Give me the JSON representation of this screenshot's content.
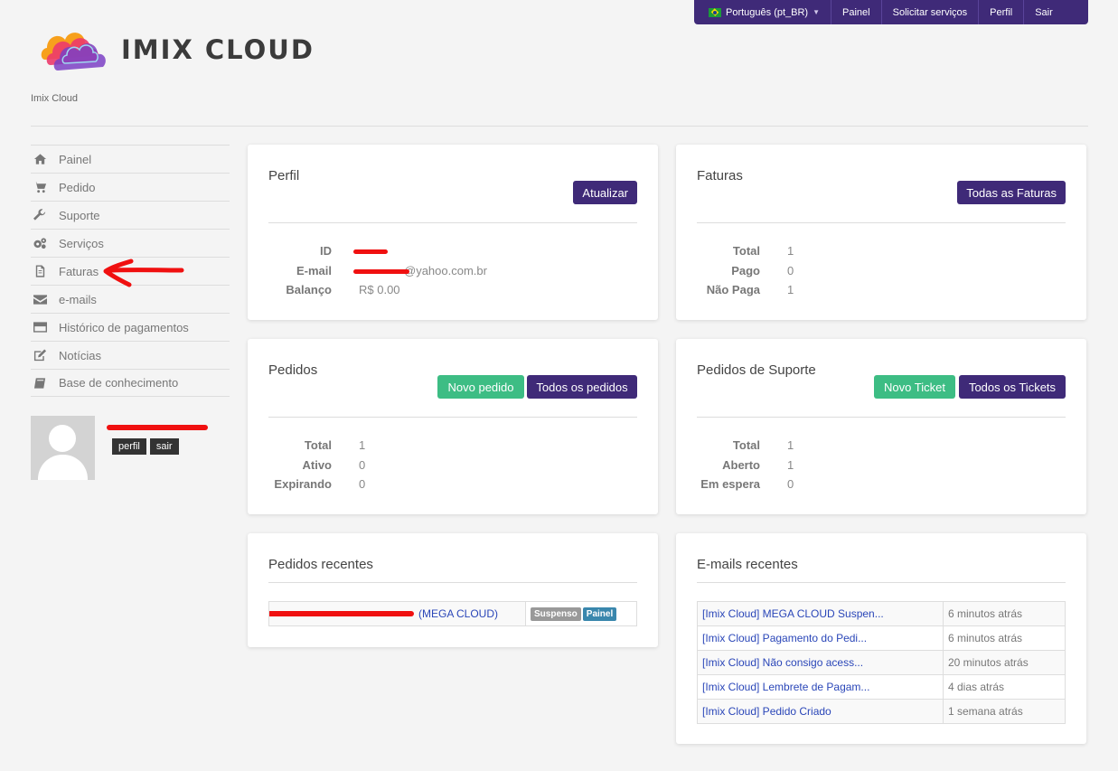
{
  "topnav": {
    "language": "Português (pt_BR)",
    "items": [
      "Painel",
      "Solicitar serviços",
      "Perfil",
      "Sair"
    ]
  },
  "brand": {
    "logo_text": "IMIX CLOUD",
    "subtitle": "Imix Cloud"
  },
  "sidebar": {
    "items": [
      {
        "label": "Painel",
        "icon": "home-icon"
      },
      {
        "label": "Pedido",
        "icon": "cart-icon"
      },
      {
        "label": "Suporte",
        "icon": "wrench-icon"
      },
      {
        "label": "Serviços",
        "icon": "gears-icon"
      },
      {
        "label": "Faturas",
        "icon": "file-icon"
      },
      {
        "label": "e-mails",
        "icon": "envelope-icon"
      },
      {
        "label": "Histórico de pagamentos",
        "icon": "credit-card-icon"
      },
      {
        "label": "Notícias",
        "icon": "edit-icon"
      },
      {
        "label": "Base de conhecimento",
        "icon": "book-icon"
      }
    ]
  },
  "user": {
    "perfil": "perfil",
    "sair": "sair"
  },
  "perfil": {
    "title": "Perfil",
    "button": "Atualizar",
    "labels": {
      "id": "ID",
      "email": "E-mail",
      "balance": "Balanço"
    },
    "values": {
      "email_suffix": "@yahoo.com.br",
      "balance": "R$ 0.00"
    }
  },
  "faturas": {
    "title": "Faturas",
    "button": "Todas as Faturas",
    "rows": [
      {
        "label": "Total",
        "value": "1"
      },
      {
        "label": "Pago",
        "value": "0"
      },
      {
        "label": "Não Paga",
        "value": "1"
      }
    ]
  },
  "pedidos": {
    "title": "Pedidos",
    "button_new": "Novo pedido",
    "button_all": "Todos os pedidos",
    "rows": [
      {
        "label": "Total",
        "value": "1"
      },
      {
        "label": "Ativo",
        "value": "0"
      },
      {
        "label": "Expirando",
        "value": "0"
      }
    ]
  },
  "suporte": {
    "title": "Pedidos de Suporte",
    "button_new": "Novo Ticket",
    "button_all": "Todos os Tickets",
    "rows": [
      {
        "label": "Total",
        "value": "1"
      },
      {
        "label": "Aberto",
        "value": "1"
      },
      {
        "label": "Em espera",
        "value": "0"
      }
    ]
  },
  "recent_orders": {
    "title": "Pedidos recentes",
    "items": [
      {
        "name_suffix": "(MEGA CLOUD)",
        "status": "Suspenso",
        "action": "Painel"
      }
    ],
    "colors": {
      "suspended": "#999999",
      "panel": "#3a87ad"
    }
  },
  "recent_emails": {
    "title": "E-mails recentes",
    "items": [
      {
        "subject": "[Imix Cloud] MEGA CLOUD Suspen...",
        "time": "6 minutos atrás"
      },
      {
        "subject": "[Imix Cloud] Pagamento do Pedi...",
        "time": "6 minutos atrás"
      },
      {
        "subject": "[Imix Cloud] Não consigo acess...",
        "time": "20 minutos atrás"
      },
      {
        "subject": "[Imix Cloud] Lembrete de Pagam...",
        "time": "4 dias atrás"
      },
      {
        "subject": "[Imix Cloud] Pedido Criado",
        "time": "1 semana atrás"
      }
    ]
  },
  "colors": {
    "primary": "#3f2a78",
    "success": "#3dbd84",
    "redaction": "#f01010"
  }
}
